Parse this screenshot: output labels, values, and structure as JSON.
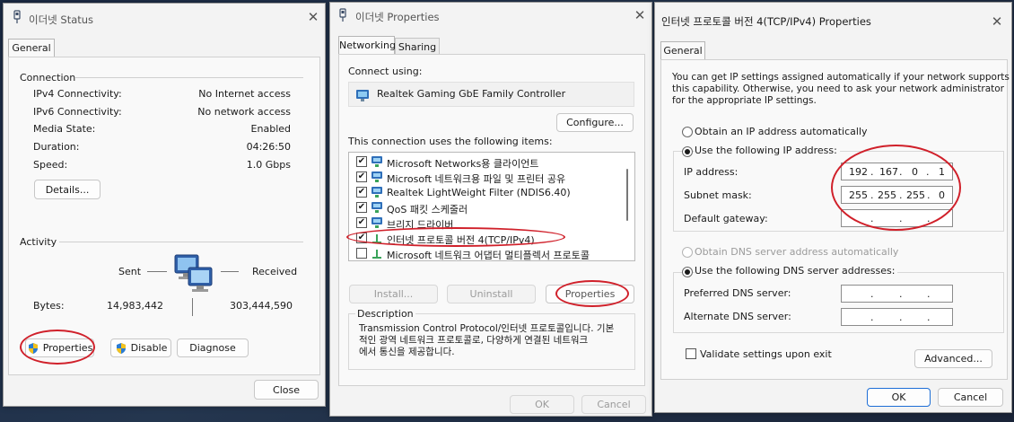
{
  "win1": {
    "title": "이더넷 Status",
    "tab_general": "General",
    "connection_heading": "Connection",
    "rows": [
      {
        "label": "IPv4 Connectivity:",
        "value": "No Internet access"
      },
      {
        "label": "IPv6 Connectivity:",
        "value": "No network access"
      },
      {
        "label": "Media State:",
        "value": "Enabled"
      },
      {
        "label": "Duration:",
        "value": "04:26:50"
      },
      {
        "label": "Speed:",
        "value": "1.0 Gbps"
      }
    ],
    "details_button": "Details...",
    "activity_heading": "Activity",
    "sent_label": "Sent",
    "received_label": "Received",
    "bytes_label": "Bytes:",
    "bytes_sent": "14,983,442",
    "bytes_received": "303,444,590",
    "properties_button": "Properties",
    "disable_button": "Disable",
    "diagnose_button": "Diagnose",
    "close_button": "Close"
  },
  "win2": {
    "title": "이더넷 Properties",
    "tab_networking": "Networking",
    "tab_sharing": "Sharing",
    "connect_using_label": "Connect using:",
    "adapter_name": "Realtek Gaming GbE Family Controller",
    "configure_button": "Configure...",
    "items_label": "This connection uses the following items:",
    "items": [
      {
        "checked": true,
        "label": "Microsoft Networks용 클라이언트"
      },
      {
        "checked": true,
        "label": "Microsoft 네트워크용 파일 및 프린터 공유"
      },
      {
        "checked": true,
        "label": "Realtek LightWeight Filter (NDIS6.40)"
      },
      {
        "checked": true,
        "label": "QoS 패킷 스케줄러"
      },
      {
        "checked": true,
        "label": "브리지 드라이버"
      },
      {
        "checked": true,
        "label": "인터넷 프로토콜 버전 4(TCP/IPv4)"
      },
      {
        "checked": false,
        "label": "Microsoft 네트워크 어댑터 멀티플렉서 프로토콜"
      }
    ],
    "install_button": "Install...",
    "uninstall_button": "Uninstall",
    "properties_button": "Properties",
    "description_heading": "Description",
    "description_text": "Transmission Control Protocol/인터넷 프로토콜입니다. 기본\n적인 광역 네트워크 프로토콜로, 다양하게 연결된 네트워크\n에서 통신을 제공합니다.",
    "ok_button": "OK",
    "cancel_button": "Cancel"
  },
  "win3": {
    "title": "인터넷 프로토콜 버전 4(TCP/IPv4) Properties",
    "tab_general": "General",
    "intro_text": "You can get IP settings assigned automatically if your network supports\nthis capability. Otherwise, you need to ask your network administrator\nfor the appropriate IP settings.",
    "obtain_ip_auto": "Obtain an IP address automatically",
    "use_following_ip": "Use the following IP address:",
    "ip_address_label": "IP address:",
    "ip_address": [
      "192",
      "167",
      "0",
      "1"
    ],
    "subnet_mask_label": "Subnet mask:",
    "subnet_mask": [
      "255",
      "255",
      "255",
      "0"
    ],
    "default_gateway_label": "Default gateway:",
    "default_gateway": [
      "",
      "",
      "",
      ""
    ],
    "obtain_dns_auto": "Obtain DNS server address automatically",
    "use_following_dns": "Use the following DNS server addresses:",
    "preferred_dns_label": "Preferred DNS server:",
    "preferred_dns": [
      "",
      "",
      "",
      ""
    ],
    "alternate_dns_label": "Alternate DNS server:",
    "alternate_dns": [
      "",
      "",
      "",
      ""
    ],
    "validate_label": "Validate settings upon exit",
    "advanced_button": "Advanced...",
    "ok_button": "OK",
    "cancel_button": "Cancel"
  },
  "colors": {
    "highlight_ring": "#d0202a",
    "primary_border": "#1d6ed6"
  }
}
